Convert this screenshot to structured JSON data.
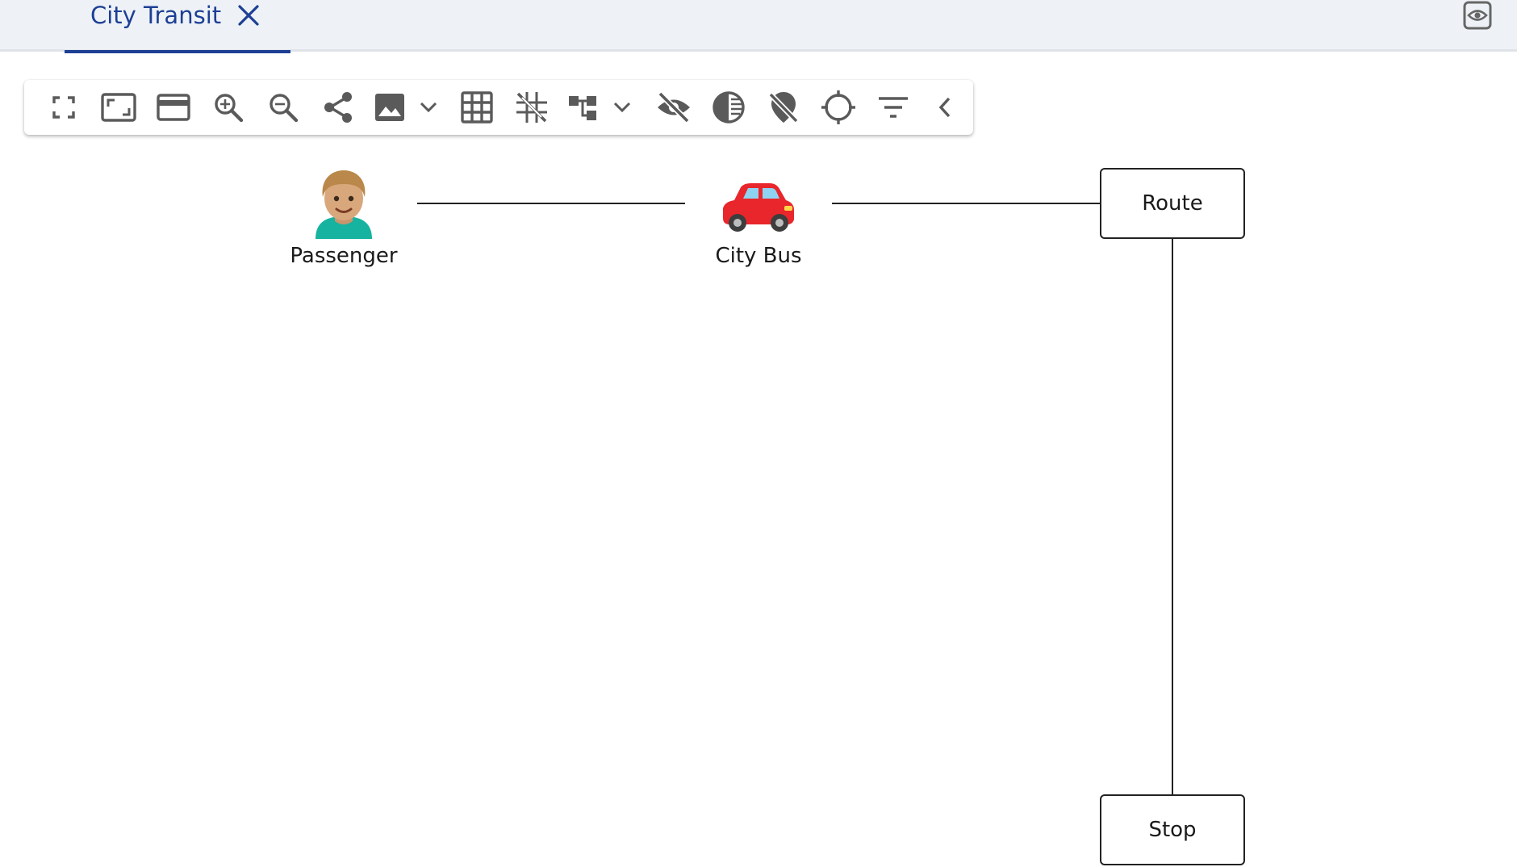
{
  "tab": {
    "title": "City Transit"
  },
  "toolbar": {
    "items": [
      {
        "icon": "fullscreen-icon"
      },
      {
        "icon": "fit-to-screen-icon"
      },
      {
        "icon": "card-view-icon"
      },
      {
        "icon": "zoom-in-icon"
      },
      {
        "icon": "zoom-out-icon"
      },
      {
        "icon": "share-icon"
      },
      {
        "icon": "image-export-icon"
      },
      {
        "icon": "grid-icon"
      },
      {
        "icon": "snap-off-icon"
      },
      {
        "icon": "hierarchy-layout-icon"
      },
      {
        "icon": "hide-icon"
      },
      {
        "icon": "contrast-icon"
      },
      {
        "icon": "location-off-icon"
      },
      {
        "icon": "crosshair-icon"
      },
      {
        "icon": "filter-icon"
      },
      {
        "icon": "collapse-chevron-icon"
      }
    ]
  },
  "graph": {
    "nodes": {
      "passenger": {
        "label": "Passenger",
        "icon": "person-emoji-icon"
      },
      "city_bus": {
        "label": "City Bus",
        "icon": "car-emoji-icon"
      },
      "route": {
        "label": "Route"
      },
      "stop": {
        "label": "Stop"
      }
    }
  },
  "colors": {
    "accent": "#1d3f94",
    "icon": "#5a5a5a",
    "tabbar_bg": "#eef2f7"
  }
}
